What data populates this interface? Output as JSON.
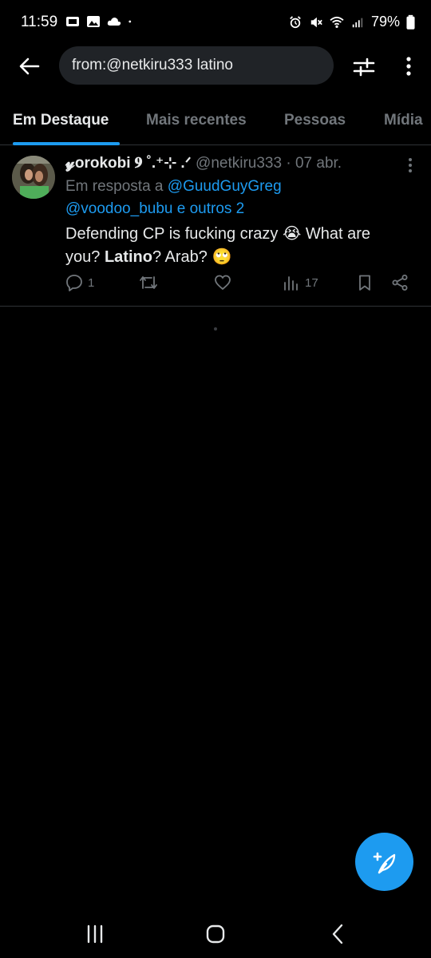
{
  "status_bar": {
    "time": "11:59",
    "battery": "79%",
    "left_icons": [
      "cast-icon",
      "gallery-icon",
      "cloud-icon",
      "dot-icon"
    ],
    "right_icons": [
      "alarm-icon",
      "mute-icon",
      "wifi-icon",
      "signal-icon",
      "battery-icon"
    ]
  },
  "search": {
    "query": "from:@netkiru333 latino"
  },
  "tabs": [
    {
      "label": "Em Destaque",
      "active": true
    },
    {
      "label": "Mais recentes",
      "active": false
    },
    {
      "label": "Pessoas",
      "active": false
    },
    {
      "label": "Mídia",
      "active": false
    }
  ],
  "tweet": {
    "display_name": "𝔂orokobi 𝟗 ˚.⁺⊹ .ᐟ",
    "handle": "@netkiru333",
    "separator": " · ",
    "date": "07 abr.",
    "reply_prefix": "Em resposta a ",
    "reply_mention_1": "@GuudGuyGreg",
    "reply_mention_2": "@voodoo_bubu e outros 2",
    "text_part_1": "Defending CP is fucking crazy 😭 What are you? ",
    "text_bold": "Latino",
    "text_part_2": "? Arab? 🙄",
    "reply_count": "1",
    "retweet_count": "",
    "like_count": "",
    "view_count": "17"
  },
  "colors": {
    "accent": "#1d9bf0",
    "background": "#000000",
    "muted": "#71767b",
    "text": "#e7e9ea"
  }
}
